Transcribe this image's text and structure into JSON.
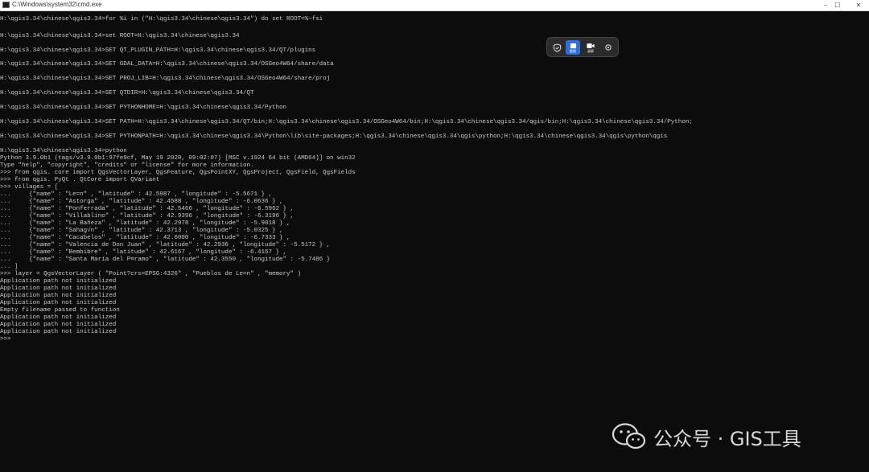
{
  "window": {
    "title": "C:\\Windows\\system32\\cmd.exe",
    "controls": {
      "minimize": "–",
      "maximize": "☐",
      "close": "✕"
    }
  },
  "console_lines": [
    "H:\\qgis3.34\\chinese\\qgis3.34>for %i in (\"H:\\qgis3.34\\chinese\\qgis3.34\") do set ROOT=%~fsi",
    "H:\\qgis3.34\\chinese\\qgis3.34>set ROOT=H:\\qgis3.34\\chinese\\qgis3.34",
    "H:\\qgis3.34\\chinese\\qgis3.34>SET QT_PLUGIN_PATH=H:\\qgis3.34\\chinese\\qgis3.34/QT/plugins",
    "H:\\qgis3.34\\chinese\\qgis3.34>SET GDAL_DATA=H:\\qgis3.34\\chinese\\qgis3.34/OSGeo4W64/share/data",
    "H:\\qgis3.34\\chinese\\qgis3.34>SET PROJ_LIB=H:\\qgis3.34\\chinese\\qgis3.34/OSGeo4W64/share/proj",
    "H:\\qgis3.34\\chinese\\qgis3.34>SET QTDIR=H:\\qgis3.34\\chinese\\qgis3.34/QT",
    "H:\\qgis3.34\\chinese\\qgis3.34>SET PYTHONHOME=H:\\qgis3.34\\chinese\\qgis3.34/Python",
    "H:\\qgis3.34\\chinese\\qgis3.34>SET PATH=H:\\qgis3.34\\chinese\\qgis3.34/QT/bin;H:\\qgis3.34\\chinese\\qgis3.34/OSGeo4W64/bin;H:\\qgis3.34\\chinese\\qgis3.34/qgis/bin;H:\\qgis3.34\\chinese\\qgis3.34/Python;",
    "H:\\qgis3.34\\chinese\\qgis3.34>SET PYTHONPATH=H:\\qgis3.34\\chinese\\qgis3.34\\Python\\lib\\site-packages;H:\\qgis3.34\\chinese\\qgis3.34\\qgis\\python;H:\\qgis3.34\\chinese\\qgis3.34\\qgis\\python\\qgis",
    "H:\\qgis3.34\\chinese\\qgis3.34>python",
    "Python 3.9.0b1 (tags/v3.9.0b1:97fe9cf, May 19 2020, 09:02:07) [MSC v.1924 64 bit (AMD64)] on win32",
    "Type \"help\", \"copyright\", \"credits\" or \"license\" for more information.",
    ">>> from qgis. core import QgsVectorLayer, QgsFeature, QgsPointXY, QgsProject, QgsField, QgsFields",
    ">>> from qgis. PyQt . QtCore import QVariant",
    ">>> villages = [",
    "...     {\"name\" : \"Le=n\" , \"latitude\" : 42.5987 , \"longitude\" : -5.5671 } ,",
    "...     {\"name\" : \"Astorga\" , \"latitude\" : 42.4588 , \"longitude\" : -6.0636 } ,",
    "...     {\"name\" : \"Ponferrada\" , \"latitude\" : 42.5466 , \"longitude\" : -6.5962 } ,",
    "...     {\"name\" : \"Villablino\" , \"latitude\" : 42.9396 , \"longitude\" : -6.3196 } ,",
    "...     {\"name\" : \"La Bañeza\" , \"latitude\" : 42.2978 , \"longitude\" : -5.9018 } ,",
    "...     {\"name\" : \"Sahag√n\" , \"latitude\" : 42.3713 , \"longitude\" : -5.0325 } ,",
    "...     {\"name\" : \"Cacabelos\" , \"latitude\" : 42.6000 , \"longitude\" : -6.7333 } ,",
    "...     {\"name\" : \"Valencia de Don Juan\" , \"latitude\" : 42.2936 , \"longitude\" : -5.5172 } ,",
    "...     {\"name\" : \"Bembibre\" , \"latitude\" : 42.6167 , \"longitude\" : -6.4167 } ,",
    "...     {\"name\" : \"Santa María del P≡ramo\" , \"latitude\" : 42.3550 , \"longitude\" : -5.7486 }",
    "... ]",
    ">>> layer = QgsVectorLayer ( \"Point?crs=EPSG:4326\" , \"Pueblos de Le=n\" , \"memory\" )",
    "Application path not initialized",
    "Application path not initialized",
    "Application path not initialized",
    "Application path not initialized",
    "Empty filename passed to function",
    "Application path not initialized",
    "Application path not initialized",
    "Application path not initialized",
    ">>>"
  ],
  "overlay_toolbar": {
    "items": [
      {
        "icon": "shield-icon",
        "label": ""
      },
      {
        "icon": "capture-icon",
        "label": "截图"
      },
      {
        "icon": "video-icon",
        "label": "录屏"
      },
      {
        "icon": "settings-icon",
        "label": ""
      }
    ]
  },
  "watermark": {
    "text": "公众号 · GIS工具"
  },
  "colors": {
    "console_bg": "#0c0c0c",
    "console_text": "#c8c8c8",
    "toolbar_accent": "#2d6fd6"
  }
}
